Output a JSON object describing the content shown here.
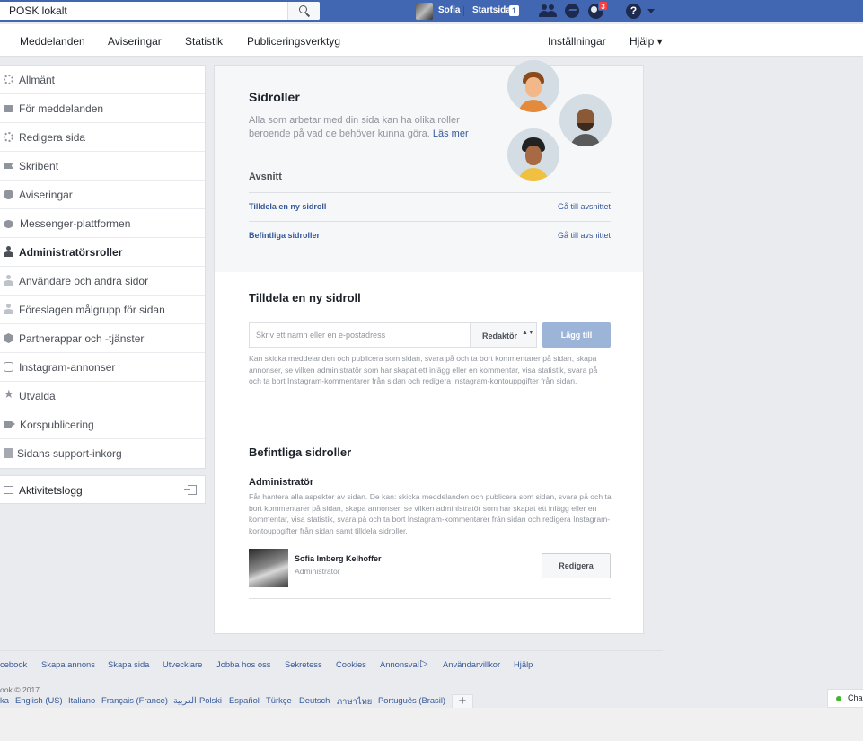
{
  "topbar": {
    "search_value": "POSK lokalt",
    "user_name": "Sofia",
    "home_label": "Startsida",
    "home_count": "1",
    "notification_count": "3",
    "help_glyph": "?",
    "icons": [
      "search-icon",
      "friends-icon",
      "messenger-icon",
      "notifications-icon",
      "help-icon",
      "chevron-down-icon"
    ],
    "brand_color": "#4267b2"
  },
  "pagenav": {
    "items": [
      "Meddelanden",
      "Aviseringar",
      "Statistik",
      "Publiceringsverktyg"
    ],
    "settings": "Inställningar",
    "help": "Hjälp ▾"
  },
  "sidebar": {
    "items": [
      {
        "label": "Allmänt",
        "icon": "gear-icon"
      },
      {
        "label": "För meddelanden",
        "icon": "chat-icon"
      },
      {
        "label": "Redigera sida",
        "icon": "gear-icon"
      },
      {
        "label": "Skribent",
        "icon": "flag-icon"
      },
      {
        "label": "Aviseringar",
        "icon": "globe-icon"
      },
      {
        "label": "Messenger-plattformen",
        "icon": "messenger-icon"
      },
      {
        "label": "Administratörsroller",
        "icon": "person-icon",
        "active": true
      },
      {
        "label": "Användare och andra sidor",
        "icon": "person-icon"
      },
      {
        "label": "Föreslagen målgrupp för sidan",
        "icon": "person-icon"
      },
      {
        "label": "Partnerappar och -tjänster",
        "icon": "cube-icon"
      },
      {
        "label": "Instagram-annonser",
        "icon": "camera-icon"
      },
      {
        "label": "Utvalda",
        "icon": "star-icon"
      },
      {
        "label": "Korspublicering",
        "icon": "video-icon"
      },
      {
        "label": "Sidans support-inkorg",
        "icon": "inbox-icon"
      }
    ],
    "activity_log": "Aktivitetslogg",
    "star_glyph": "★"
  },
  "header": {
    "title": "Sidroller",
    "description": "Alla som arbetar med din sida kan ha olika roller beroende på vad de behöver kunna göra.",
    "learn_more": "Läs mer",
    "sections_label": "Avsnitt",
    "sections": [
      {
        "label": "Tilldela en ny sidroll",
        "link": "Gå till avsnittet"
      },
      {
        "label": "Befintliga sidroller",
        "link": "Gå till avsnittet"
      }
    ]
  },
  "assign": {
    "title": "Tilldela en ny sidroll",
    "placeholder": "Skriv ett namn eller en e-postadress",
    "role_value": "Redaktör",
    "role_arrows": "▲▼",
    "add_button": "Lägg till",
    "help_text": "Kan skicka meddelanden och publicera som sidan, svara på och ta bort kommentarer på sidan, skapa annonser, se vilken administratör som har skapat ett inlägg eller en kommentar, visa statistik, svara på och ta bort Instagram-kommentarer från sidan och redigera Instagram-kontouppgifter från sidan."
  },
  "existing": {
    "title": "Befintliga sidroller",
    "role_heading": "Administratör",
    "role_description": "Får hantera alla aspekter av sidan. De kan: skicka meddelanden och publicera som sidan, svara på och ta bort kommentarer på sidan, skapa annonser, se vilken administratör som har skapat ett inlägg eller en kommentar, visa statistik, svara på och ta bort Instagram-kommentarer från sidan och redigera Instagram-kontouppgifter från sidan samt tilldela sidroller.",
    "user_name": "Sofia Imberg Kelhoffer",
    "user_role": "Administratör",
    "edit_button": "Redigera"
  },
  "footer": {
    "links": [
      "cebook",
      "Skapa annons",
      "Skapa sida",
      "Utvecklare",
      "Jobba hos oss",
      "Sekretess",
      "Cookies",
      "Annonsval",
      "Användarvillkor",
      "Hjälp"
    ],
    "adchoices_glyph": "▷",
    "copyright": "ook © 2017",
    "languages": [
      "ka",
      "English (US)",
      "Italiano",
      "Français (France)",
      "العربية",
      "Polski",
      "Español",
      "Türkçe",
      "Deutsch",
      "ภาษาไทย",
      "Português (Brasil)"
    ],
    "plus": "+"
  },
  "chat": {
    "label": "Cha",
    "status_color": "#42b72a"
  }
}
